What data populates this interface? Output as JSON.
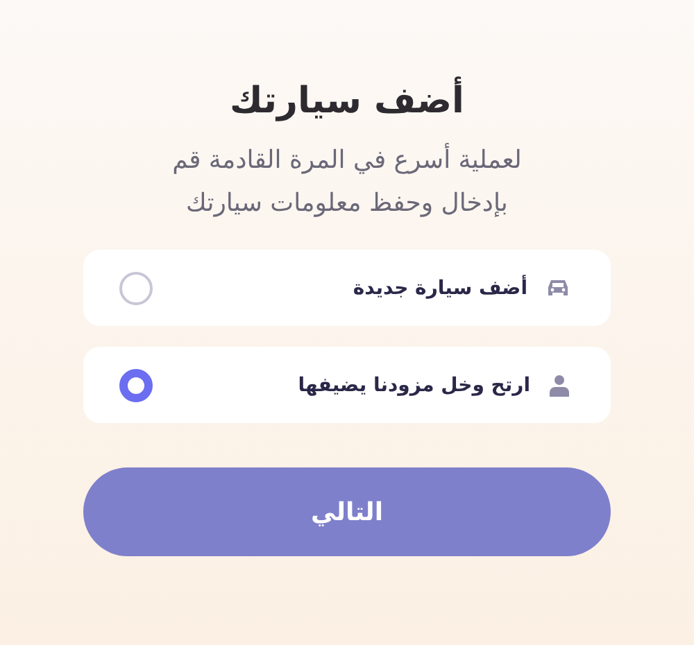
{
  "title": "أضف سيارتك",
  "subtitle": "لعملية أسرع في المرة القادمة قم بإدخال وحفظ معلومات سيارتك",
  "options": [
    {
      "kind": "car",
      "label": "أضف سيارة جديدة",
      "selected": false
    },
    {
      "kind": "person",
      "label": "ارتح وخل مزودنا يضيفها",
      "selected": true
    }
  ],
  "next_button": "التالي"
}
